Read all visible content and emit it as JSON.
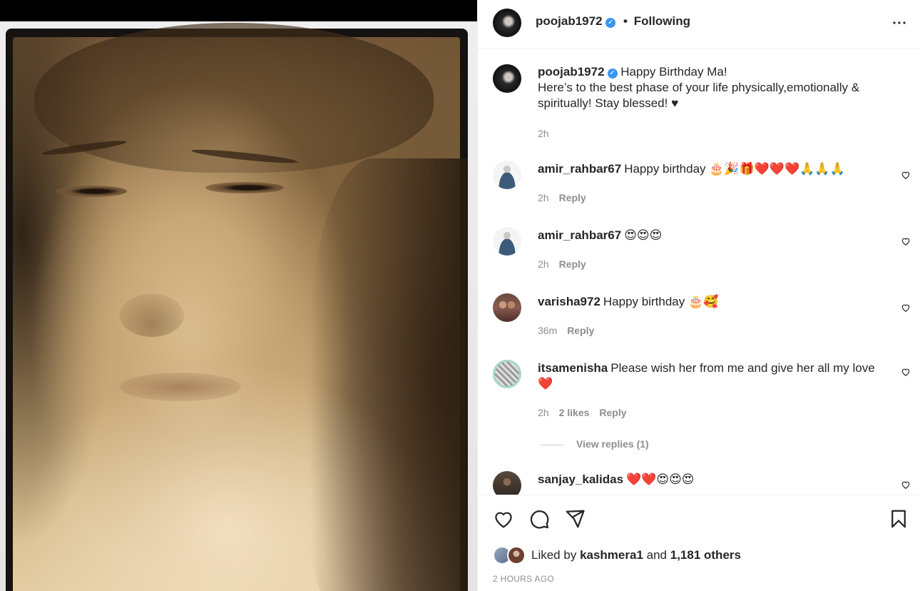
{
  "post": {
    "author": "poojab1972",
    "follow_status": "Following",
    "dot": "•",
    "more_icon": "more-horizontal-icon",
    "caption_line1": "Happy Birthday Ma!",
    "caption_line2": "Here’s to the best phase of your life physically,emotionally & spiritually! Stay blessed! ♥",
    "caption_time": "2h"
  },
  "comments": [
    {
      "user": "amir_rahbar67",
      "text": "Happy birthday 🎂🎉🎁❤️❤️❤️🙏🙏🙏",
      "time": "2h",
      "reply": "Reply"
    },
    {
      "user": "amir_rahbar67",
      "text": "😍😍😍",
      "time": "2h",
      "reply": "Reply"
    },
    {
      "user": "varisha972",
      "text": "Happy birthday 🎂🥰",
      "time": "36m",
      "reply": "Reply"
    },
    {
      "user": "itsamenisha",
      "text": "Please wish her from me and give her all my love ❤️",
      "time": "2h",
      "likes": "2 likes",
      "reply": "Reply",
      "view_replies": "View replies (1)"
    },
    {
      "user": "sanjay_kalidas",
      "text": "❤️❤️😍😍😍"
    }
  ],
  "footer": {
    "liked_by": "Liked by",
    "liker": "kashmera1",
    "and": "and",
    "others": "1,181 others",
    "time_ago": "2 HOURS AGO"
  },
  "colors": {
    "verified": "#3897f0",
    "muted": "#8e8e8e",
    "text": "#262626",
    "border": "#efefef"
  }
}
